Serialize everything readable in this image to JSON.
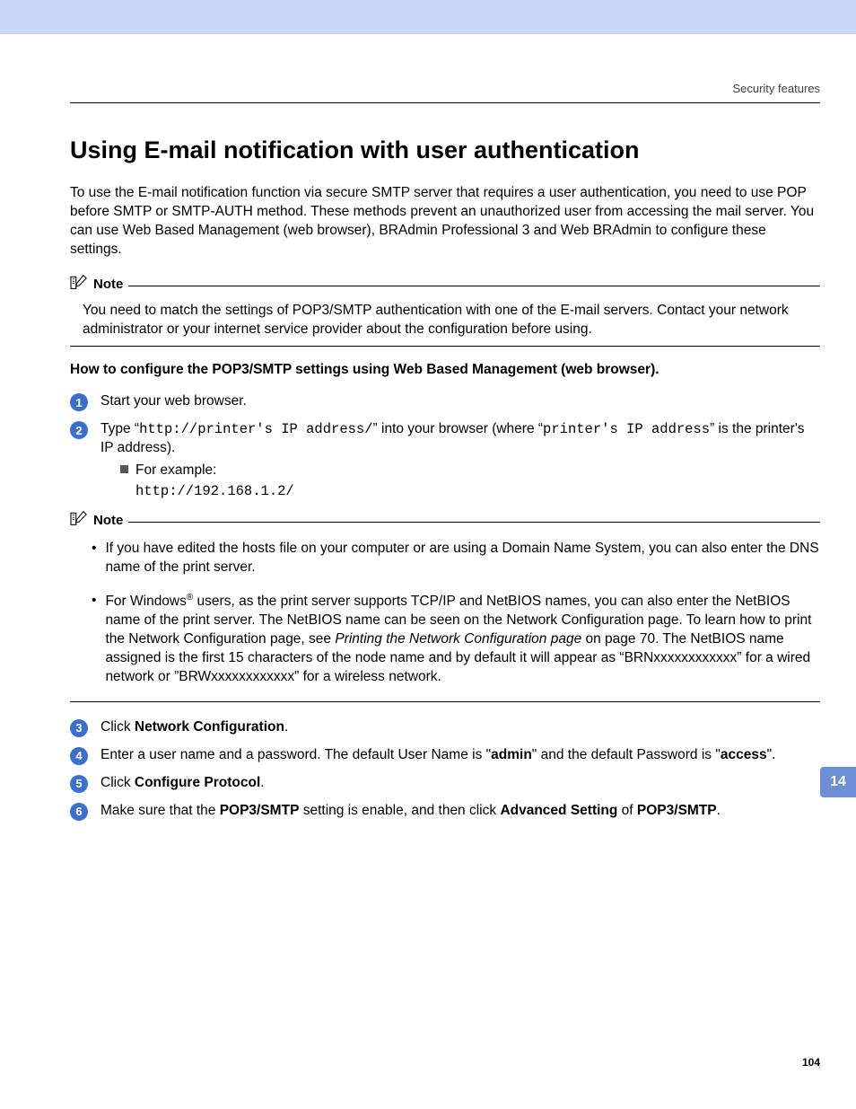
{
  "header": {
    "section_label": "Security features"
  },
  "title": "Using E-mail notification with user authentication",
  "intro": "To use the E-mail notification function via secure SMTP server that requires a user authentication, you need to use POP before SMTP or SMTP-AUTH method. These methods prevent an unauthorized user from accessing the mail server. You can use Web Based Management (web browser), BRAdmin Professional 3 and Web BRAdmin to configure these settings.",
  "note1": {
    "label": "Note",
    "text": "You need to match the settings of POP3/SMTP authentication with one of the E-mail servers. Contact your network administrator or your internet service provider about the configuration before using."
  },
  "subhead": "How to configure the POP3/SMTP settings using Web Based Management (web browser).",
  "steps": {
    "s1": {
      "num": "1",
      "text": "Start your web browser."
    },
    "s2": {
      "num": "2",
      "pre": "Type “",
      "url1": "http://printer's IP address/",
      "mid": "” into your browser (where “",
      "url2": "printer's IP address",
      "post": "” is the printer's IP address).",
      "example_label": "For example:",
      "example_url": "http://192.168.1.2/"
    },
    "s3": {
      "num": "3",
      "pre": "Click ",
      "bold": "Network Configuration",
      "post": "."
    },
    "s4": {
      "num": "4",
      "pre": "Enter a user name and a password. The default User Name is \"",
      "b1": "admin",
      "mid": "\" and the default Password is \"",
      "b2": "access",
      "post": "\"."
    },
    "s5": {
      "num": "5",
      "pre": "Click ",
      "bold": "Configure Protocol",
      "post": "."
    },
    "s6": {
      "num": "6",
      "pre": "Make sure that the ",
      "b1": "POP3/SMTP",
      "mid1": " setting is enable, and then click ",
      "b2": "Advanced Setting",
      "mid2": " of ",
      "b3": "POP3/SMTP",
      "post": "."
    }
  },
  "note2": {
    "label": "Note",
    "bullet1": "If you have edited the hosts file on your computer or are using a Domain Name System, you can also enter the DNS name of the print server.",
    "bullet2_pre": "For Windows",
    "bullet2_sup": "®",
    "bullet2_mid": " users, as the print server supports TCP/IP and NetBIOS names, you can also enter the NetBIOS name of the print server. The NetBIOS name can be seen on the Network Configuration page. To learn how to print the Network Configuration page, see ",
    "bullet2_link": "Printing the Network Configuration page",
    "bullet2_post": " on page 70. The NetBIOS name assigned is the first 15 characters of the node name and by default it will appear as “BRNxxxxxxxxxxxx” for a wired network or ”BRWxxxxxxxxxxxx” for a wireless network."
  },
  "side_tab": "14",
  "page_number": "104"
}
